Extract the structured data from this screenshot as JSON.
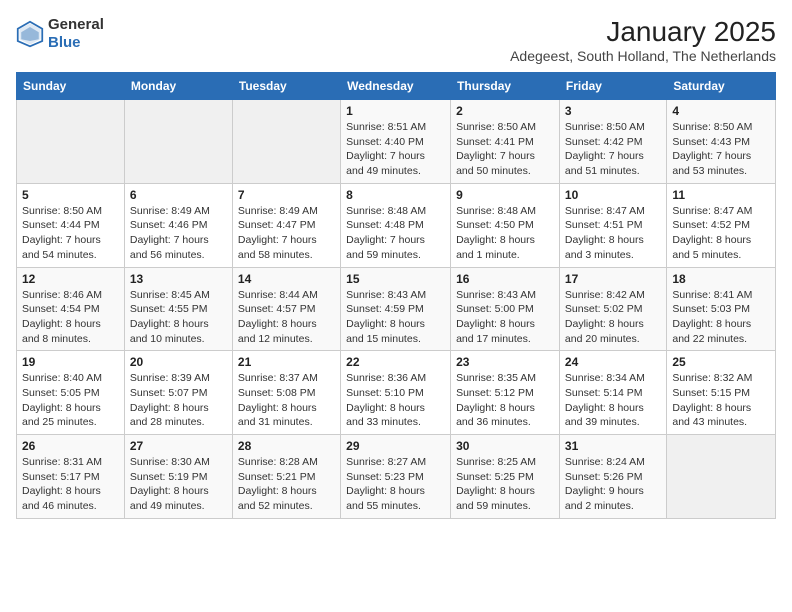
{
  "header": {
    "logo_general": "General",
    "logo_blue": "Blue",
    "month_year": "January 2025",
    "location": "Adegeest, South Holland, The Netherlands"
  },
  "weekdays": [
    "Sunday",
    "Monday",
    "Tuesday",
    "Wednesday",
    "Thursday",
    "Friday",
    "Saturday"
  ],
  "weeks": [
    [
      {
        "day": "",
        "info": ""
      },
      {
        "day": "",
        "info": ""
      },
      {
        "day": "",
        "info": ""
      },
      {
        "day": "1",
        "info": "Sunrise: 8:51 AM\nSunset: 4:40 PM\nDaylight: 7 hours and 49 minutes."
      },
      {
        "day": "2",
        "info": "Sunrise: 8:50 AM\nSunset: 4:41 PM\nDaylight: 7 hours and 50 minutes."
      },
      {
        "day": "3",
        "info": "Sunrise: 8:50 AM\nSunset: 4:42 PM\nDaylight: 7 hours and 51 minutes."
      },
      {
        "day": "4",
        "info": "Sunrise: 8:50 AM\nSunset: 4:43 PM\nDaylight: 7 hours and 53 minutes."
      }
    ],
    [
      {
        "day": "5",
        "info": "Sunrise: 8:50 AM\nSunset: 4:44 PM\nDaylight: 7 hours and 54 minutes."
      },
      {
        "day": "6",
        "info": "Sunrise: 8:49 AM\nSunset: 4:46 PM\nDaylight: 7 hours and 56 minutes."
      },
      {
        "day": "7",
        "info": "Sunrise: 8:49 AM\nSunset: 4:47 PM\nDaylight: 7 hours and 58 minutes."
      },
      {
        "day": "8",
        "info": "Sunrise: 8:48 AM\nSunset: 4:48 PM\nDaylight: 7 hours and 59 minutes."
      },
      {
        "day": "9",
        "info": "Sunrise: 8:48 AM\nSunset: 4:50 PM\nDaylight: 8 hours and 1 minute."
      },
      {
        "day": "10",
        "info": "Sunrise: 8:47 AM\nSunset: 4:51 PM\nDaylight: 8 hours and 3 minutes."
      },
      {
        "day": "11",
        "info": "Sunrise: 8:47 AM\nSunset: 4:52 PM\nDaylight: 8 hours and 5 minutes."
      }
    ],
    [
      {
        "day": "12",
        "info": "Sunrise: 8:46 AM\nSunset: 4:54 PM\nDaylight: 8 hours and 8 minutes."
      },
      {
        "day": "13",
        "info": "Sunrise: 8:45 AM\nSunset: 4:55 PM\nDaylight: 8 hours and 10 minutes."
      },
      {
        "day": "14",
        "info": "Sunrise: 8:44 AM\nSunset: 4:57 PM\nDaylight: 8 hours and 12 minutes."
      },
      {
        "day": "15",
        "info": "Sunrise: 8:43 AM\nSunset: 4:59 PM\nDaylight: 8 hours and 15 minutes."
      },
      {
        "day": "16",
        "info": "Sunrise: 8:43 AM\nSunset: 5:00 PM\nDaylight: 8 hours and 17 minutes."
      },
      {
        "day": "17",
        "info": "Sunrise: 8:42 AM\nSunset: 5:02 PM\nDaylight: 8 hours and 20 minutes."
      },
      {
        "day": "18",
        "info": "Sunrise: 8:41 AM\nSunset: 5:03 PM\nDaylight: 8 hours and 22 minutes."
      }
    ],
    [
      {
        "day": "19",
        "info": "Sunrise: 8:40 AM\nSunset: 5:05 PM\nDaylight: 8 hours and 25 minutes."
      },
      {
        "day": "20",
        "info": "Sunrise: 8:39 AM\nSunset: 5:07 PM\nDaylight: 8 hours and 28 minutes."
      },
      {
        "day": "21",
        "info": "Sunrise: 8:37 AM\nSunset: 5:08 PM\nDaylight: 8 hours and 31 minutes."
      },
      {
        "day": "22",
        "info": "Sunrise: 8:36 AM\nSunset: 5:10 PM\nDaylight: 8 hours and 33 minutes."
      },
      {
        "day": "23",
        "info": "Sunrise: 8:35 AM\nSunset: 5:12 PM\nDaylight: 8 hours and 36 minutes."
      },
      {
        "day": "24",
        "info": "Sunrise: 8:34 AM\nSunset: 5:14 PM\nDaylight: 8 hours and 39 minutes."
      },
      {
        "day": "25",
        "info": "Sunrise: 8:32 AM\nSunset: 5:15 PM\nDaylight: 8 hours and 43 minutes."
      }
    ],
    [
      {
        "day": "26",
        "info": "Sunrise: 8:31 AM\nSunset: 5:17 PM\nDaylight: 8 hours and 46 minutes."
      },
      {
        "day": "27",
        "info": "Sunrise: 8:30 AM\nSunset: 5:19 PM\nDaylight: 8 hours and 49 minutes."
      },
      {
        "day": "28",
        "info": "Sunrise: 8:28 AM\nSunset: 5:21 PM\nDaylight: 8 hours and 52 minutes."
      },
      {
        "day": "29",
        "info": "Sunrise: 8:27 AM\nSunset: 5:23 PM\nDaylight: 8 hours and 55 minutes."
      },
      {
        "day": "30",
        "info": "Sunrise: 8:25 AM\nSunset: 5:25 PM\nDaylight: 8 hours and 59 minutes."
      },
      {
        "day": "31",
        "info": "Sunrise: 8:24 AM\nSunset: 5:26 PM\nDaylight: 9 hours and 2 minutes."
      },
      {
        "day": "",
        "info": ""
      }
    ]
  ]
}
